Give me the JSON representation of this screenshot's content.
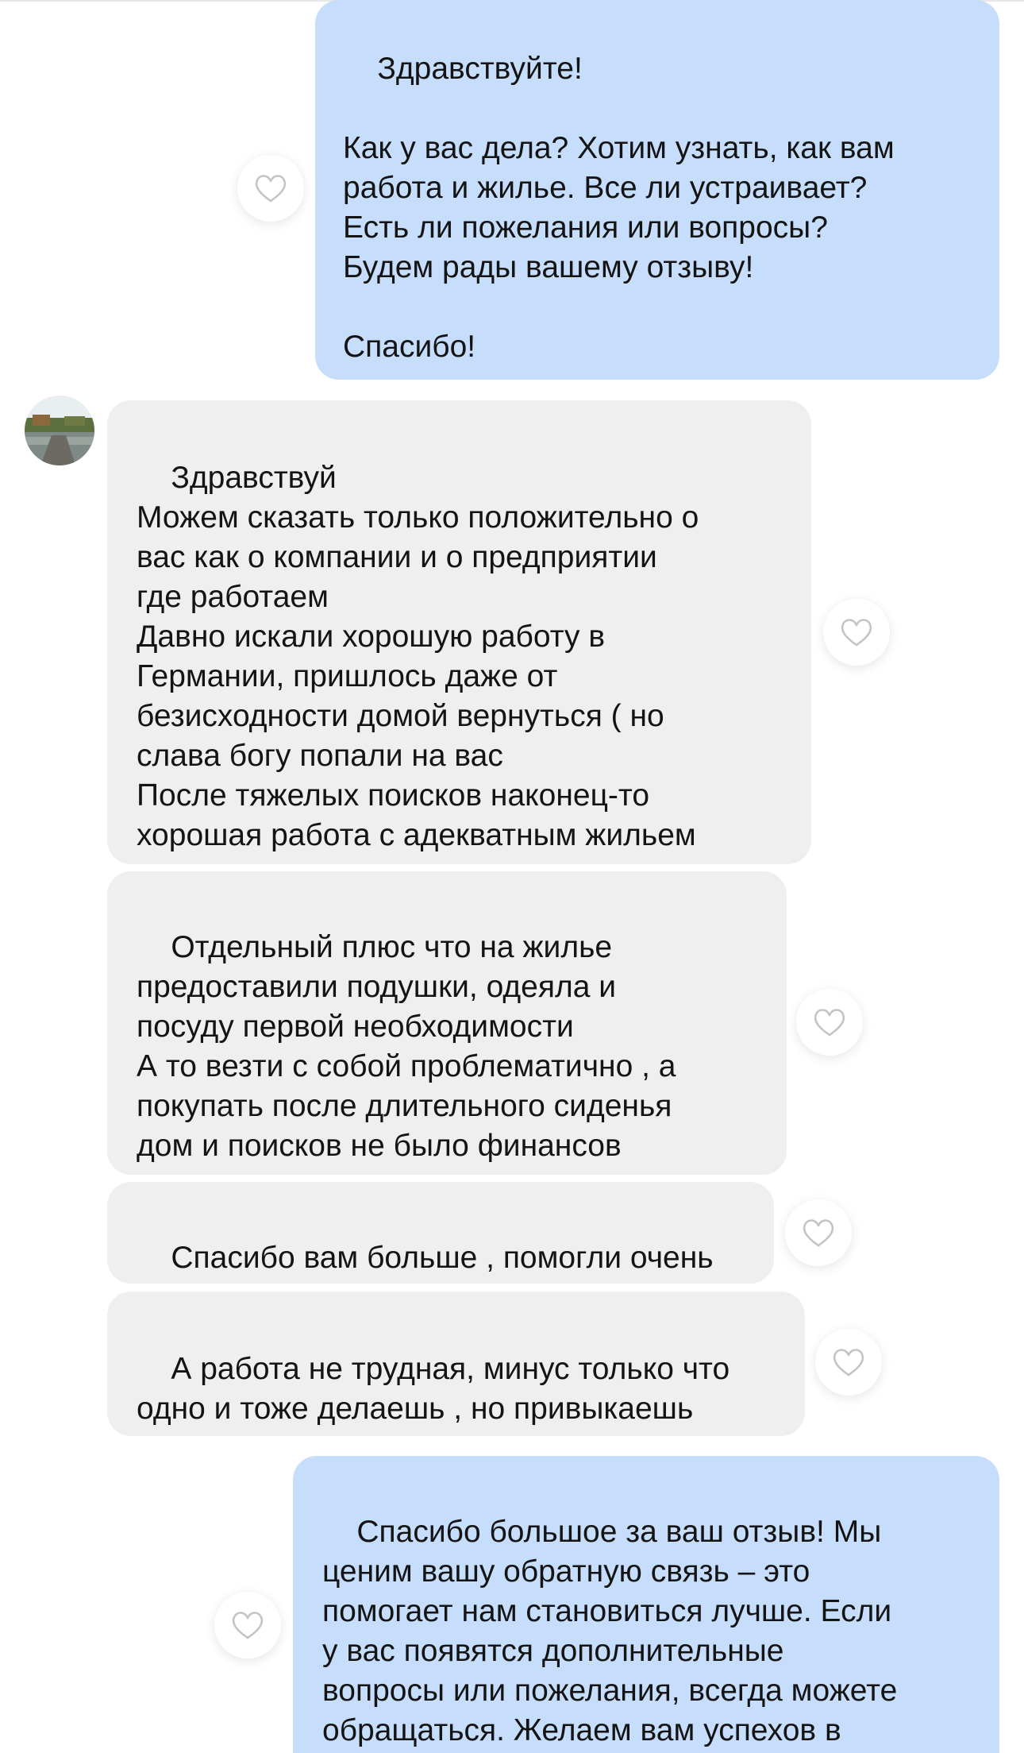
{
  "messages": [
    {
      "id": "m1",
      "direction": "outgoing",
      "text": "Здравствуйте!\n\nКак у вас дела? Хотим узнать, как вам\nработа и жилье. Все ли устраивает?\nЕсть ли пожелания или вопросы?\nБудем рады вашему отзыву!\n\nСпасибо!"
    },
    {
      "id": "m2",
      "direction": "incoming",
      "text": "Здравствуй\nМожем сказать только положительно о\nвас как о компании и о предприятии\nгде работаем\nДавно искали хорошую работу в\nГермании, пришлось даже от\nбезисходности домой вернуться ( но\nслава богу попали на вас\nПосле тяжелых поисков наконец-то\nхорошая работа с адекватным жильем"
    },
    {
      "id": "m3",
      "direction": "incoming",
      "text": "Отдельный плюс что на жилье\nпредоставили подушки, одеяла и\nпосуду первой необходимости\nА то везти с собой проблематично , а\nпокупать после длительного сиденья\nдом и поисков не было финансов"
    },
    {
      "id": "m4",
      "direction": "incoming",
      "text": "Спасибо вам больше , помогли очень"
    },
    {
      "id": "m5",
      "direction": "incoming",
      "text": "А работа не трудная, минус только что\nодно и тоже делаешь , но привыкаешь"
    },
    {
      "id": "m6",
      "direction": "outgoing",
      "text": "Спасибо большое за ваш отзыв! Мы\nценим вашу обратную связь – это\nпомогает нам становиться лучше. Если\nу вас появятся дополнительные\nвопросы или пожелания, всегда можете\nобращаться. Желаем вам успехов в\nработе!"
    }
  ],
  "icons": {
    "like": "heart-outline-icon",
    "avatar": "lake-landscape-photo"
  },
  "colors": {
    "outgoing_bubble": "#c6defb",
    "incoming_bubble": "#efefef",
    "text": "#141414",
    "heart_stroke": "#c4c4c4"
  }
}
